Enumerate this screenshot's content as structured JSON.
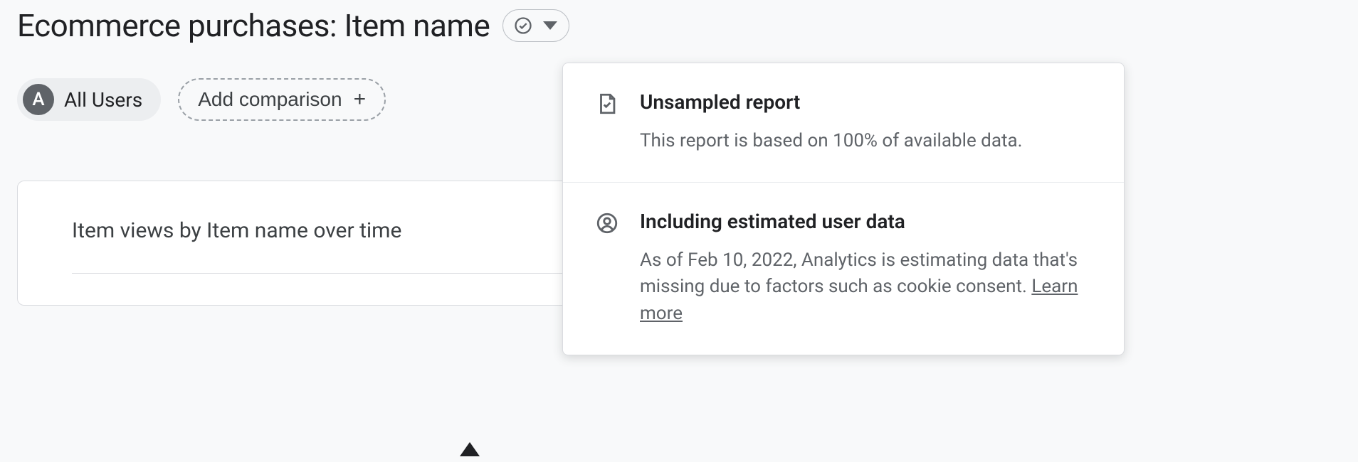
{
  "header": {
    "title": "Ecommerce purchases: Item name"
  },
  "filters": {
    "segment_letter": "A",
    "segment_label": "All Users",
    "add_comparison_label": "Add comparison"
  },
  "card": {
    "title": "Item views by Item name over time"
  },
  "status_panel": {
    "items": [
      {
        "title": "Unsampled report",
        "desc": "This report is based on 100% of available data."
      },
      {
        "title": "Including estimated user data",
        "desc_prefix": "As of Feb 10, 2022, Analytics is estimating data that's missing due to factors such as cookie consent. ",
        "learn_more": "Learn more"
      }
    ]
  }
}
